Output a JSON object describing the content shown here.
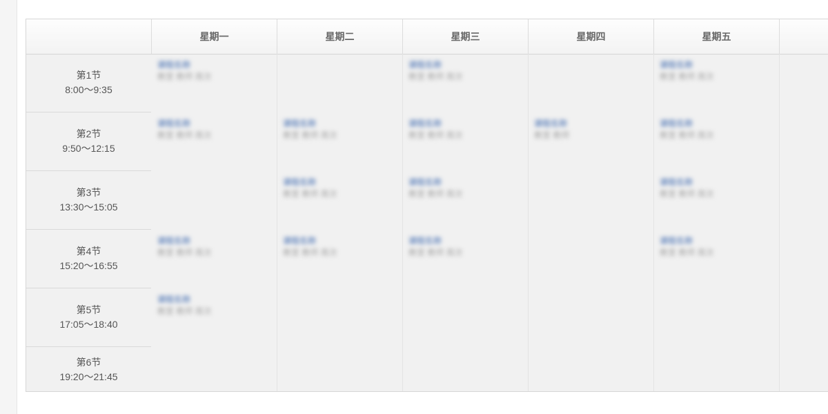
{
  "timetable": {
    "days": [
      "星期一",
      "星期二",
      "星期三",
      "星期四",
      "星期五",
      ""
    ],
    "periods": [
      {
        "name": "第1节",
        "time": "8:00～9:35"
      },
      {
        "name": "第2节",
        "time": "9:50～12:15"
      },
      {
        "name": "第3节",
        "time": "13:30～15:05"
      },
      {
        "name": "第4节",
        "time": "15:20～16:55"
      },
      {
        "name": "第5节",
        "time": "17:05～18:40"
      },
      {
        "name": "第6节",
        "time": "19:20～21:45"
      }
    ],
    "courses": {
      "c_mon_1": {
        "name": "课程名称",
        "info": "教室 教师 周次"
      },
      "c_wed_1": {
        "name": "课程名称",
        "info": "教室 教师 周次"
      },
      "c_fri_1": {
        "name": "课程名称",
        "info": "教室 教师 周次"
      },
      "c_mon_2": {
        "name": "课程名称",
        "info": "教室 教师 周次"
      },
      "c_tue_2": {
        "name": "课程名称",
        "info": "教室 教师 周次"
      },
      "c_wed_2": {
        "name": "课程名称",
        "info": "教室 教师 周次"
      },
      "c_thu_2": {
        "name": "课程名称",
        "info": "教室 教师"
      },
      "c_fri_2": {
        "name": "课程名称",
        "info": "教室 教师 周次"
      },
      "c_tue_3": {
        "name": "课程名称",
        "info": "教室 教师 周次"
      },
      "c_wed_3": {
        "name": "课程名称",
        "info": "教室 教师 周次"
      },
      "c_fri_3": {
        "name": "课程名称",
        "info": "教室 教师 周次"
      },
      "c_mon_4": {
        "name": "课程名称",
        "info": "教室 教师 周次"
      },
      "c_tue_4": {
        "name": "课程名称",
        "info": "教室 教师 周次"
      },
      "c_wed_4": {
        "name": "课程名称",
        "info": "教室 教师 周次"
      },
      "c_fri_4": {
        "name": "课程名称",
        "info": "教室 教师 周次"
      },
      "c_mon_5": {
        "name": "课程名称",
        "info": "教室 教师 周次"
      }
    }
  }
}
